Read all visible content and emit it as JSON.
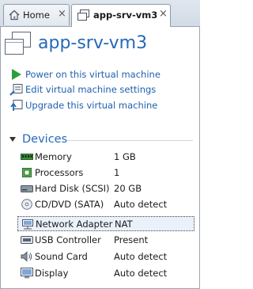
{
  "tabs": [
    {
      "label": "Home",
      "icon": "home-icon",
      "close": "×"
    },
    {
      "label": "app-srv-vm3",
      "icon": "vm-icon",
      "close": "×"
    }
  ],
  "vm": {
    "title": "app-srv-vm3"
  },
  "actions": [
    {
      "label": "Power on this virtual machine",
      "icon": "play-icon"
    },
    {
      "label": "Edit virtual machine settings",
      "icon": "settings-icon"
    },
    {
      "label": "Upgrade this virtual machine",
      "icon": "upgrade-icon"
    }
  ],
  "devices": {
    "title": "Devices",
    "items": [
      {
        "name": "Memory",
        "value": "1 GB",
        "icon": "memory-icon"
      },
      {
        "name": "Processors",
        "value": "1",
        "icon": "processor-icon"
      },
      {
        "name": "Hard Disk (SCSI)",
        "value": "20 GB",
        "icon": "hard-disk-icon"
      },
      {
        "name": "CD/DVD (SATA)",
        "value": "Auto detect",
        "icon": "cd-dvd-icon"
      },
      {
        "name": "Network Adapter",
        "value": "NAT",
        "icon": "network-adapter-icon",
        "selected": true
      },
      {
        "name": "USB Controller",
        "value": "Present",
        "icon": "usb-icon"
      },
      {
        "name": "Sound Card",
        "value": "Auto detect",
        "icon": "sound-card-icon"
      },
      {
        "name": "Display",
        "value": "Auto detect",
        "icon": "display-icon"
      }
    ]
  },
  "colors": {
    "accent": "#2569b8",
    "link": "#1f5fb0",
    "play": "#2e9e3c"
  }
}
